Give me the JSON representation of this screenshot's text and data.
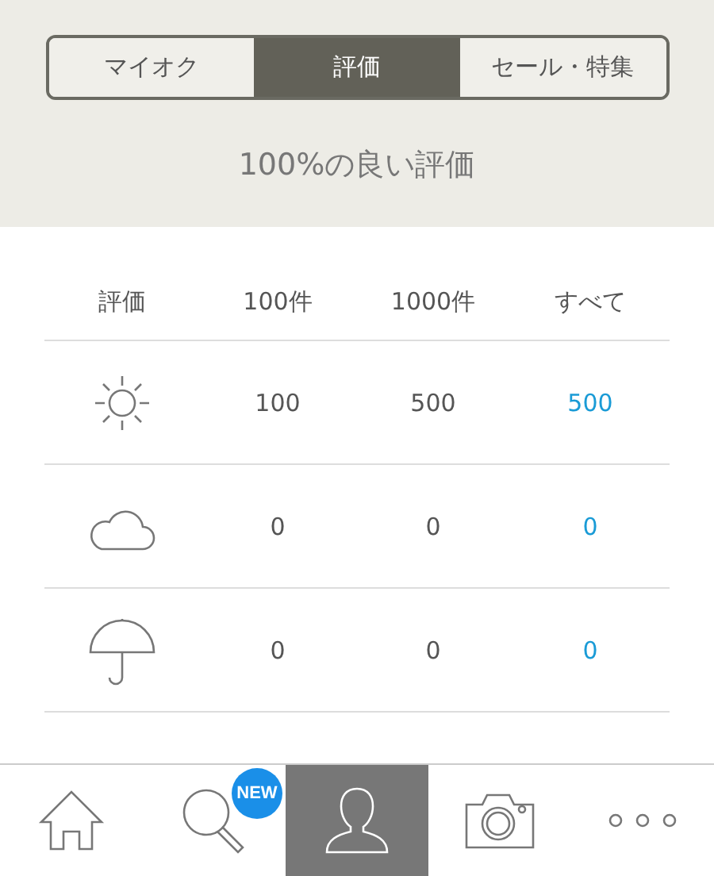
{
  "tabs": [
    {
      "label": "マイオク",
      "selected": false
    },
    {
      "label": "評価",
      "selected": true
    },
    {
      "label": "セール・特集",
      "selected": false
    }
  ],
  "summary": "100%の良い評価",
  "table": {
    "icon_column": "評価",
    "columns": [
      "100件",
      "1000件",
      "すべて"
    ],
    "rows": [
      {
        "kind": "sun",
        "cells": [
          "100",
          "500",
          "500"
        ]
      },
      {
        "kind": "cloud",
        "cells": [
          "0",
          "0",
          "0"
        ]
      },
      {
        "kind": "umbrella",
        "cells": [
          "0",
          "0",
          "0"
        ]
      }
    ]
  },
  "tab_bar": [
    {
      "kind": "home",
      "selected": false
    },
    {
      "kind": "search",
      "selected": false,
      "badge": "NEW"
    },
    {
      "kind": "user",
      "selected": true
    },
    {
      "kind": "camera",
      "selected": false
    },
    {
      "kind": "more",
      "selected": false
    }
  ]
}
